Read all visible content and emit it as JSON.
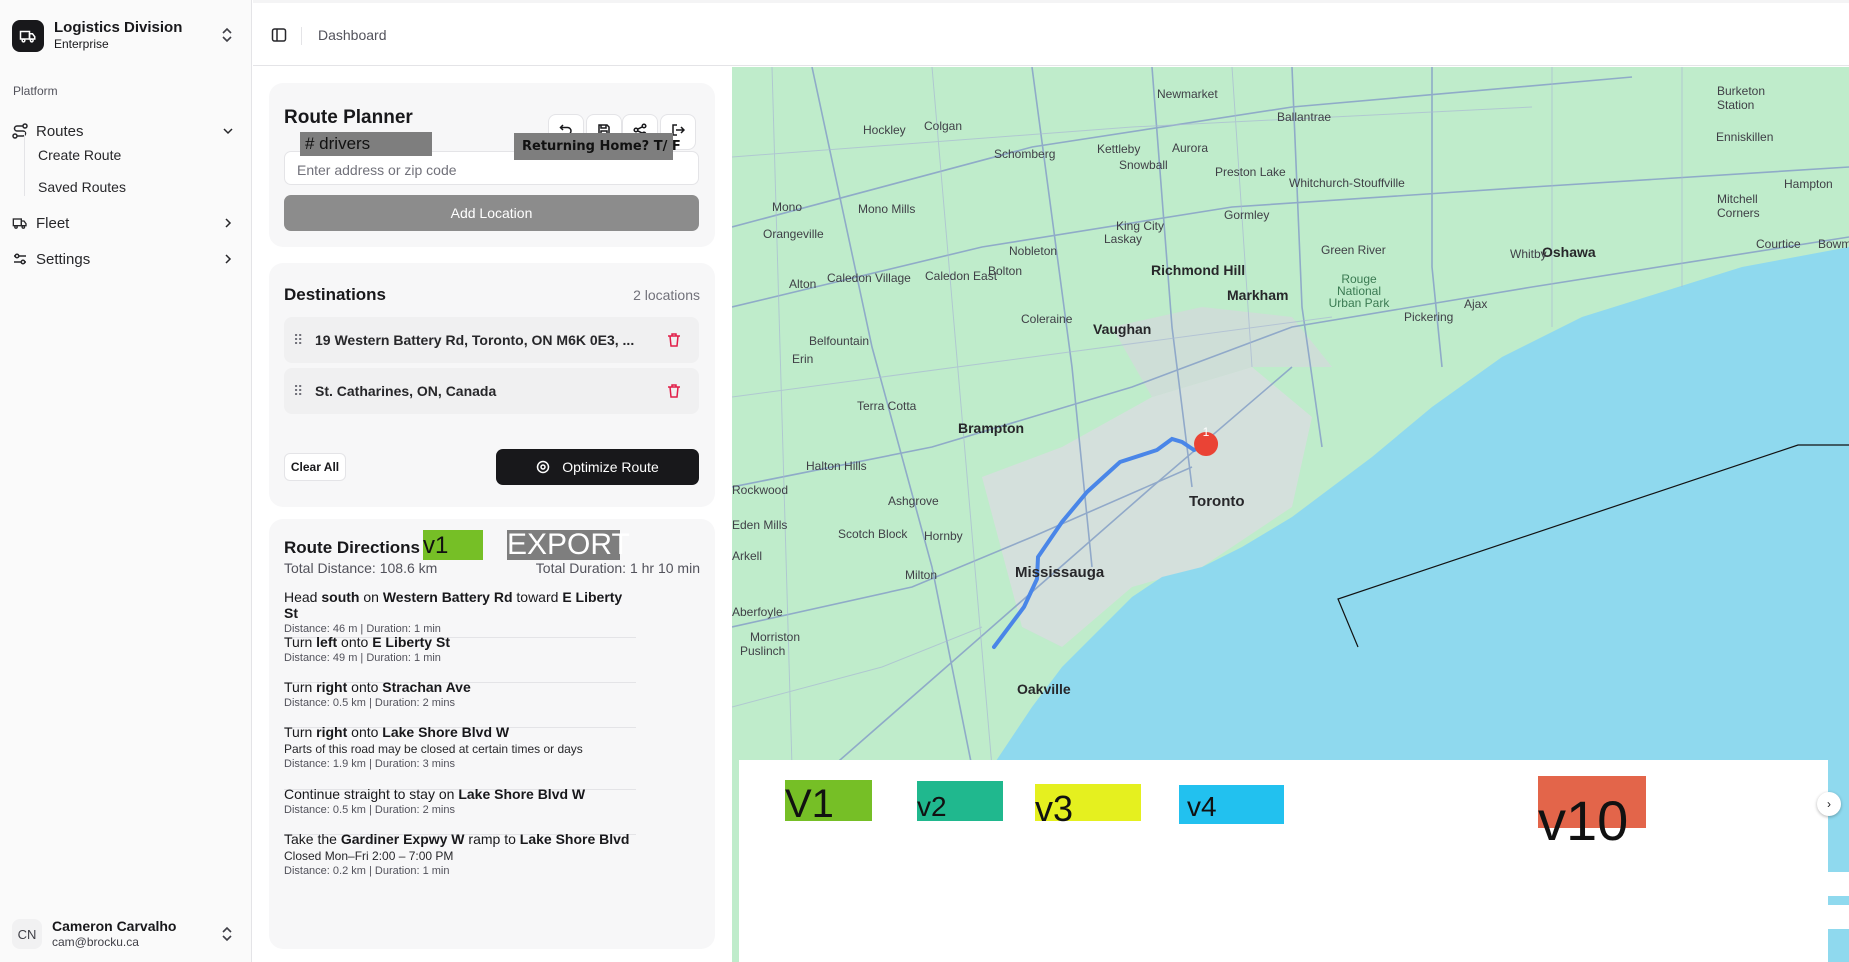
{
  "org": {
    "name": "Logistics Division",
    "plan": "Enterprise"
  },
  "sidebar": {
    "section": "Platform",
    "items": [
      {
        "label": "Routes",
        "icon": "route-icon"
      },
      {
        "label": "Fleet",
        "icon": "truck-icon"
      },
      {
        "label": "Settings",
        "icon": "sliders-icon"
      }
    ],
    "routes_sub": [
      "Create Route",
      "Saved Routes"
    ]
  },
  "user": {
    "initials": "CN",
    "name": "Cameron Carvalho",
    "email": "cam@brocku.ca"
  },
  "header": {
    "breadcrumb": "Dashboard"
  },
  "planner": {
    "title": "Route Planner",
    "drivers_label": "# drivers",
    "returning_label": "Returning Home? T/ F",
    "address_placeholder": "Enter address or zip code",
    "add_label": "Add Location"
  },
  "destinations": {
    "title": "Destinations",
    "count": "2 locations",
    "items": [
      "19 Western Battery Rd, Toronto, ON M6K 0E3, ...",
      "St. Catharines, ON, Canada"
    ],
    "clear_label": "Clear All",
    "optimize_label": "Optimize Route"
  },
  "directions": {
    "title": "Route Directions",
    "v1_label": "v1",
    "export_label": "EXPORT",
    "total_distance": "Total Distance: 108.6 km",
    "total_duration": "Total Duration: 1 hr 10 min",
    "steps": [
      {
        "text": "Head south on Western Battery Rd toward E Liberty St",
        "note": "",
        "meta": "Distance: 46 m | Duration: 1 min"
      },
      {
        "text": "Turn left onto E Liberty St",
        "note": "",
        "meta": "Distance: 49 m | Duration: 1 min"
      },
      {
        "text": "Turn right onto Strachan Ave",
        "note": "",
        "meta": "Distance: 0.5 km | Duration: 2 mins"
      },
      {
        "text": "Turn right onto Lake Shore Blvd W",
        "note": "Parts of this road may be closed at certain times or days",
        "meta": "Distance: 1.9 km | Duration: 3 mins"
      },
      {
        "text": "Continue straight to stay on Lake Shore Blvd W",
        "note": "",
        "meta": "Distance: 0.5 km | Duration: 2 mins"
      },
      {
        "text": "Take the Gardiner Expwy W ramp to Lake Shore Blvd",
        "note": "Closed Mon–Fri 2:00 – 7:00 PM",
        "meta": "Distance: 0.2 km | Duration: 1 min"
      }
    ]
  },
  "map": {
    "marker_label": "1",
    "places_major": [
      "Toronto",
      "Mississauga",
      "Brampton",
      "Vaughan",
      "Richmond Hill",
      "Markham",
      "Oshawa",
      "Oakville"
    ],
    "places_minor": [
      "Newmarket",
      "Aurora",
      "Ballantrae",
      "Hockley",
      "Colgan",
      "Schomberg",
      "Kettleby",
      "Snowball",
      "Preston Lake",
      "Whitchurch-Stouffville",
      "Mono",
      "Mono Mills",
      "Orangeville",
      "Nobleton",
      "King City",
      "Laskay",
      "Gormley",
      "Green River",
      "Caledon East",
      "Bolton",
      "Caledon Village",
      "Alton",
      "Coleraine",
      "Belfountain",
      "Erin",
      "Terra Cotta",
      "Halton Hills",
      "Ashgrove",
      "Rockwood",
      "Eden Mills",
      "Scotch Block",
      "Hornby",
      "Milton",
      "Morriston",
      "Puslinch",
      "Aberfoyle",
      "Arkell",
      "Burketon Station",
      "Enniskillen",
      "Hampton",
      "Mitchell Corners",
      "Courtice",
      "Bowmanville",
      "Whitby",
      "Ajax",
      "Pickering",
      "Rouge National Urban Park"
    ],
    "legend": [
      "V1",
      "v2",
      "v3",
      "v4",
      "v10"
    ],
    "legend_colors": [
      "#76bf26",
      "#20b88e",
      "#e5f01f",
      "#22c1ef",
      "#e3654a"
    ],
    "route_color": "#4a86e8",
    "water_color": "#8fd9ee",
    "land_color": "#bfeccb"
  }
}
